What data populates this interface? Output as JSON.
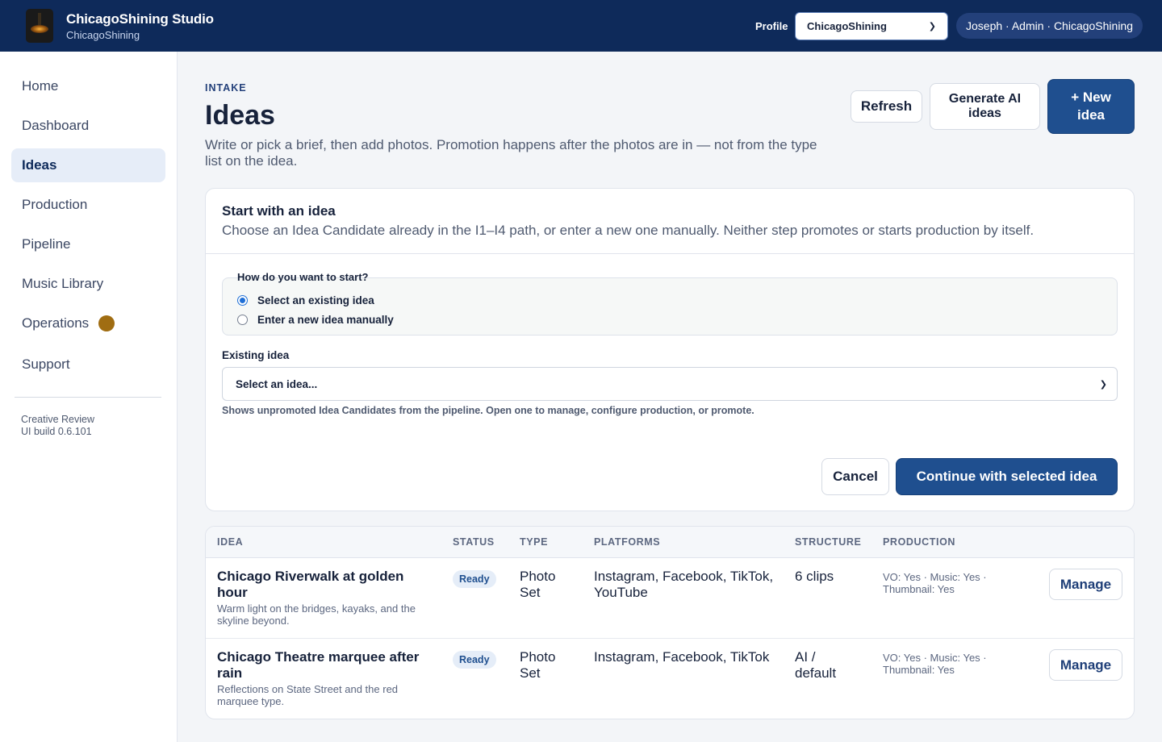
{
  "header": {
    "brand_title": "ChicagoShining Studio",
    "brand_subtitle": "ChicagoShining",
    "profile_label": "Profile",
    "profile_value": "ChicagoShining",
    "user": "Joseph · Admin · ChicagoShining"
  },
  "sidebar": {
    "items": [
      {
        "label": "Home"
      },
      {
        "label": "Dashboard"
      },
      {
        "label": "Ideas"
      },
      {
        "label": "Production"
      },
      {
        "label": "Pipeline"
      },
      {
        "label": "Music Library"
      },
      {
        "label": "Operations"
      },
      {
        "label": "Support"
      }
    ],
    "active": "Ideas",
    "footer_line1": "Creative Review",
    "footer_line2": "UI build 0.6.101"
  },
  "page": {
    "eyebrow": "INTAKE",
    "title": "Ideas",
    "description": "Write or pick a brief, then add photos. Promotion happens after the photos are in — not from the type list on the idea.",
    "buttons": {
      "refresh": "Refresh",
      "generate": "Generate AI ideas",
      "new_idea": "+ New idea"
    }
  },
  "start_card": {
    "title": "Start with an idea",
    "subtitle": "Choose an Idea Candidate already in the I1–I4 path, or enter a new one manually. Neither step promotes or starts production by itself.",
    "question": "How do you want to start?",
    "options": [
      {
        "label": "Select an existing idea",
        "checked": true
      },
      {
        "label": "Enter a new idea manually",
        "checked": false
      }
    ],
    "existing_label": "Existing idea",
    "select_value": "Select an idea...",
    "help": "Shows unpromoted Idea Candidates from the pipeline. Open one to manage, configure production, or promote.",
    "cancel": "Cancel",
    "continue": "Continue with selected idea"
  },
  "table": {
    "columns": [
      "IDEA",
      "STATUS",
      "TYPE",
      "PLATFORMS",
      "STRUCTURE",
      "PRODUCTION"
    ],
    "rows": [
      {
        "title": "Chicago Riverwalk at golden hour",
        "description": "Warm light on the bridges, kayaks, and the skyline beyond.",
        "status": "Ready",
        "type": "Photo Set",
        "platforms": "Instagram, Facebook, TikTok, YouTube",
        "structure": "6 clips",
        "production": "VO: Yes · Music: Yes · Thumbnail: Yes",
        "action": "Manage"
      },
      {
        "title": "Chicago Theatre marquee after rain",
        "description": "Reflections on State Street and the red marquee type.",
        "status": "Ready",
        "type": "Photo Set",
        "platforms": "Instagram, Facebook, TikTok",
        "structure": "AI / default",
        "production": "VO: Yes · Music: Yes · Thumbnail: Yes",
        "action": "Manage"
      }
    ]
  },
  "colors": {
    "header_bg": "#0e2a5a",
    "primary": "#1f4f8f",
    "operations_dot": "#a06d12"
  }
}
